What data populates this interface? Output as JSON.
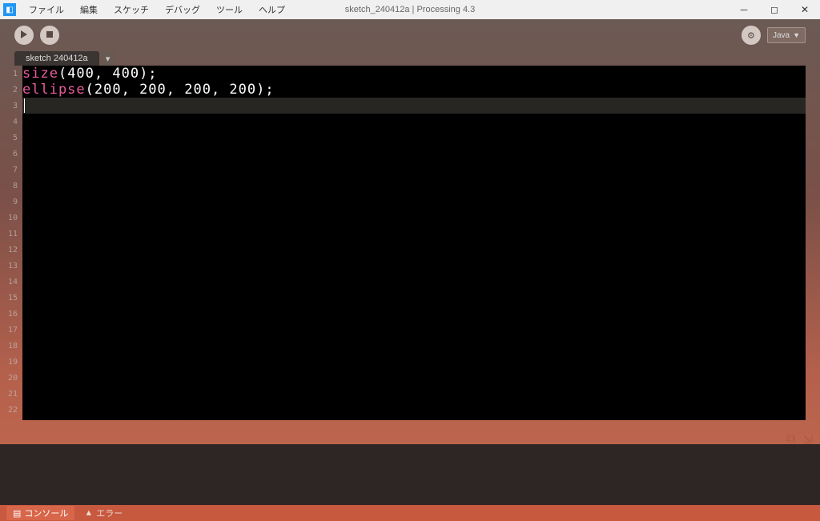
{
  "window": {
    "title": "sketch_240412a | Processing 4.3"
  },
  "menu": {
    "items": [
      "ファイル",
      "編集",
      "スケッチ",
      "デバッグ",
      "ツール",
      "ヘルプ"
    ]
  },
  "mode": {
    "label": "Java"
  },
  "tab": {
    "name": "sketch 240412a"
  },
  "code": {
    "lines": [
      {
        "kw": "size",
        "rest": "(400, 400);"
      },
      {
        "kw": "ellipse",
        "rest": "(200, 200, 200, 200);"
      }
    ],
    "total_lines": 22,
    "current_line": 3
  },
  "status": {
    "console": "コンソール",
    "errors": "エラー"
  }
}
